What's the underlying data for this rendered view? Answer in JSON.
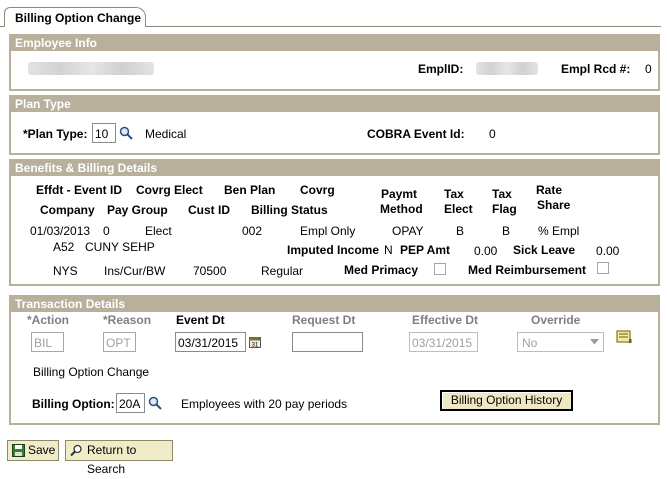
{
  "tab": {
    "label": "Billing Option Change"
  },
  "employee_info": {
    "header": "Employee Info",
    "emplid_label": "EmplID:",
    "empl_rcd_label": "Empl Rcd #:",
    "empl_rcd_value": "0"
  },
  "plan_type": {
    "header": "Plan Type",
    "plan_type_label": "*Plan Type:",
    "plan_type_value": "10",
    "plan_type_desc": "Medical",
    "cobra_label": "COBRA Event Id:",
    "cobra_value": "0"
  },
  "benefits": {
    "header": "Benefits & Billing Details",
    "col_effdt_event": "Effdt - Event ID",
    "col_covrg_elect": "Covrg Elect",
    "col_ben_plan": "Ben Plan",
    "col_covrg": "Covrg",
    "col_paymt": "Paymt",
    "col_method": "Method",
    "col_tax1": "Tax",
    "col_elect": "Elect",
    "col_tax2": "Tax",
    "col_flag": "Flag",
    "col_rate": "Rate",
    "col_share": "Share",
    "col_company": "Company",
    "col_pay_group": "Pay Group",
    "col_cust_id": "Cust ID",
    "col_billing_status": "Billing Status",
    "row_effdt": "01/03/2013",
    "row_event": "0",
    "row_elect": "Elect",
    "row_ben_plan": "002",
    "row_covrg": "Empl Only",
    "row_paymt": "OPAY",
    "row_tax_elect": "B",
    "row_tax_flag": "B",
    "row_rate_share": "% Empl",
    "row_company": "A52",
    "row_pay_group": "CUNY SEHP",
    "imputed_label": "Imputed Income",
    "imputed_value": "N",
    "pep_label": "PEP Amt",
    "pep_value": "0.00",
    "sick_label": "Sick Leave",
    "sick_value": "0.00",
    "row_nys": "NYS",
    "row_ins": "Ins/Cur/BW",
    "row_cust_id": "70500",
    "row_billing_status": "Regular",
    "med_primacy_label": "Med Primacy",
    "med_reimb_label": "Med Reimbursement"
  },
  "transaction": {
    "header": "Transaction Details",
    "action_label": "*Action",
    "reason_label": "*Reason",
    "event_dt_label": "Event Dt",
    "request_dt_label": "Request Dt",
    "effective_dt_label": "Effective Dt",
    "override_label": "Override",
    "action_value": "BIL",
    "reason_value": "OPT",
    "event_dt_value": "03/31/2015",
    "request_dt_value": "",
    "effective_dt_value": "03/31/2015",
    "override_value": "No",
    "action_desc": "Billing Option Change",
    "billing_option_label": "Billing Option:",
    "billing_option_value": "20A",
    "billing_option_desc": "Employees with 20 pay periods",
    "history_button": "Billing Option History"
  },
  "buttons": {
    "save": "Save",
    "return": "Return to Search"
  },
  "icons": {
    "lookup": "magnifier-icon",
    "calendar": "calendar-icon",
    "dropdown": "chevron-down-icon",
    "note": "note-icon",
    "save": "save-disk-icon",
    "return": "search-return-icon"
  },
  "colors": {
    "group_header": "#b9b09c",
    "button_bg": "#efe8c5"
  }
}
